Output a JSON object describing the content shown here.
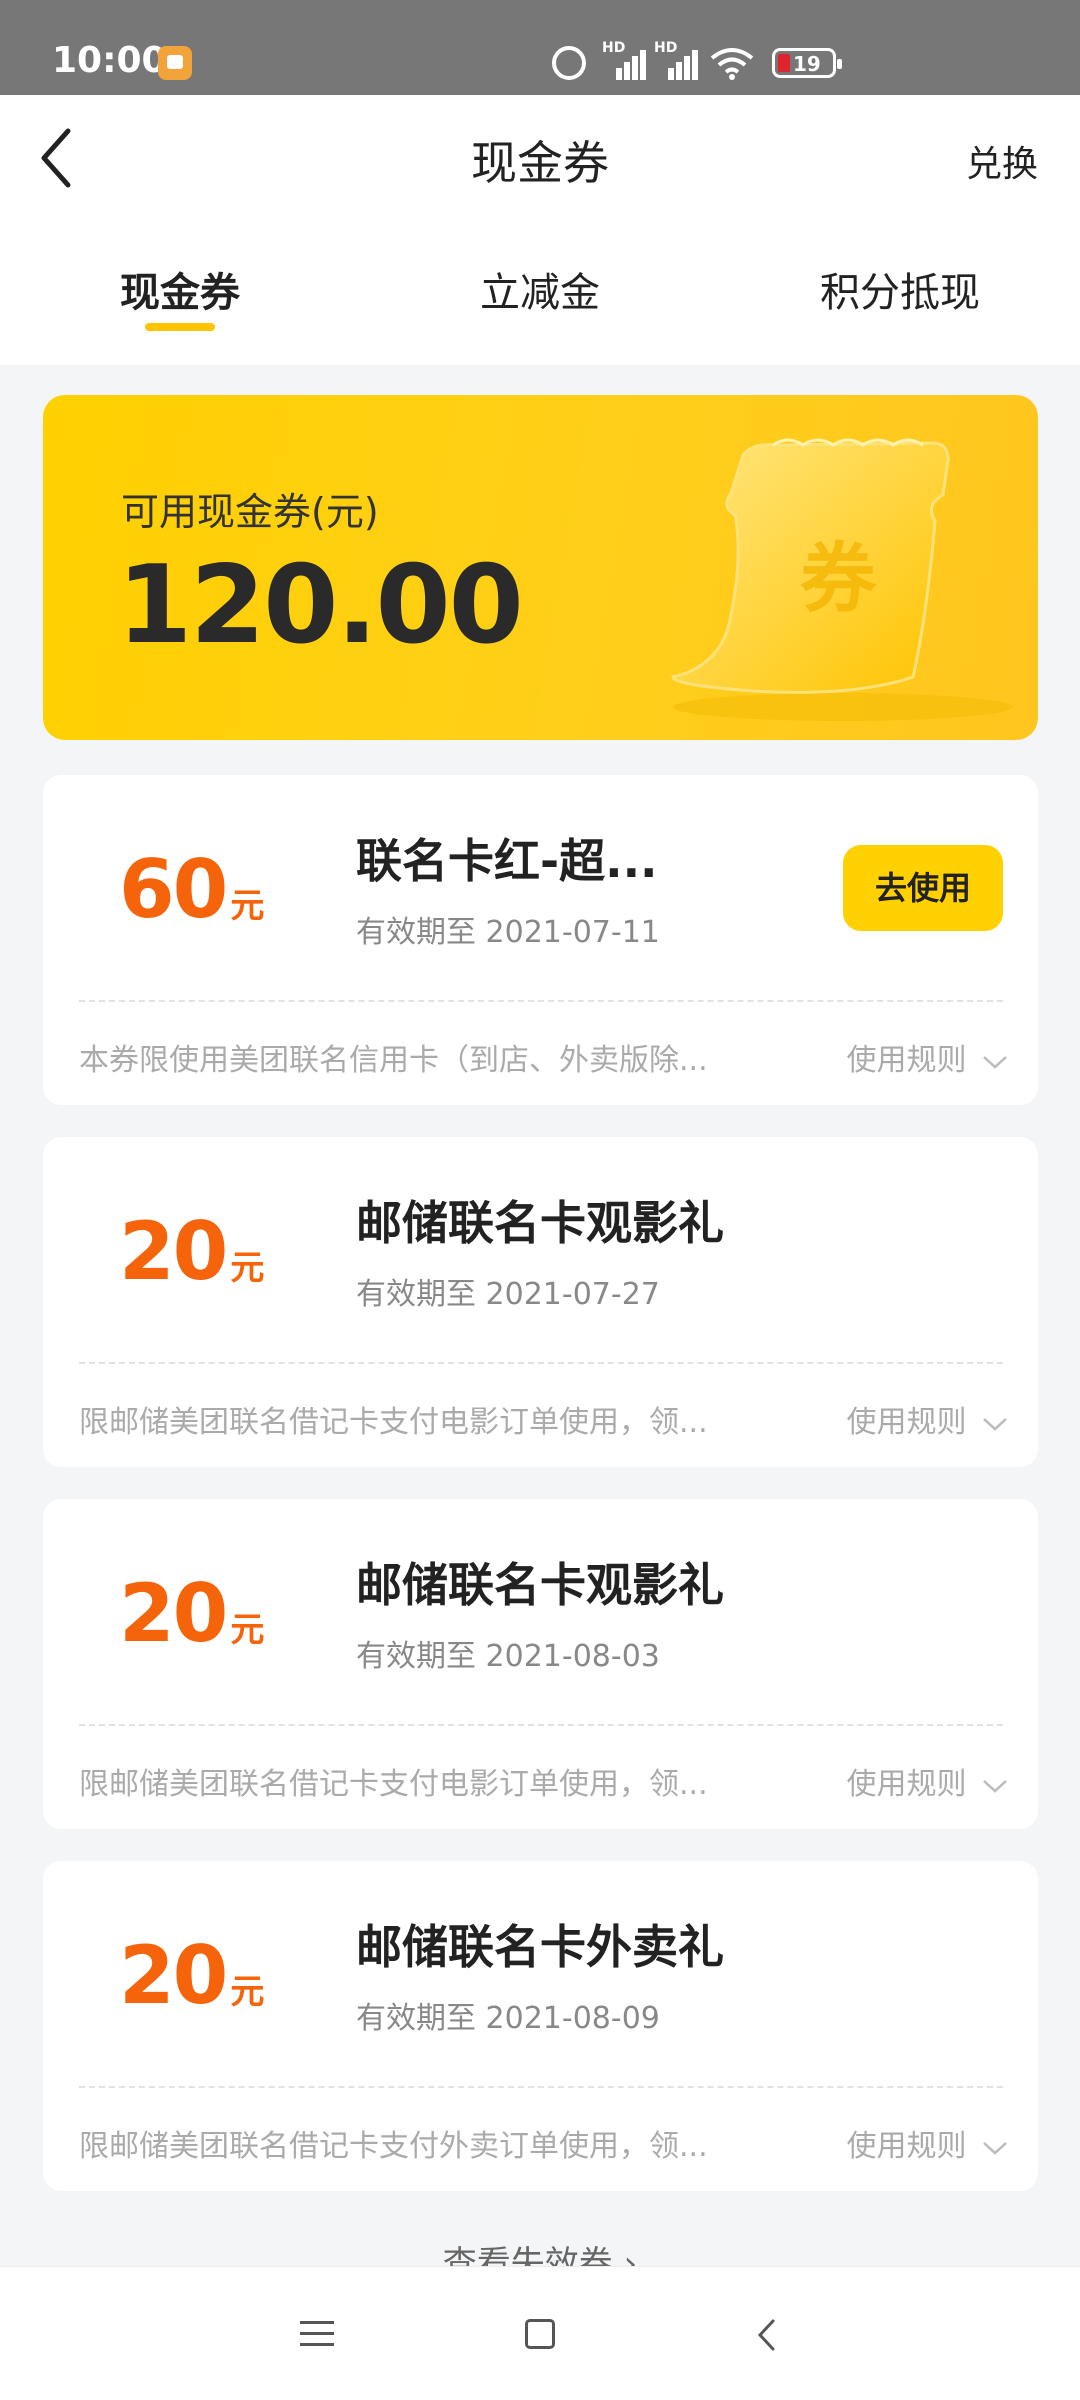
{
  "status_bar": {
    "time": "10:00",
    "battery": "19",
    "signal_label": "HD"
  },
  "header": {
    "title": "现金券",
    "exchange": "兑换"
  },
  "tabs": [
    {
      "label": "现金券",
      "active": true
    },
    {
      "label": "立减金",
      "active": false
    },
    {
      "label": "积分抵现",
      "active": false
    }
  ],
  "summary": {
    "label": "可用现金券(元)",
    "amount": "120.00",
    "ticket_text": "券"
  },
  "coupons": [
    {
      "amount": "60",
      "unit": "元",
      "name": "联名卡红-超...",
      "valid": "有效期至 2021-07-11",
      "use_label": "去使用",
      "desc": "本券限使用美团联名信用卡（到店、外卖版除...",
      "rules": "使用规则"
    },
    {
      "amount": "20",
      "unit": "元",
      "name": "邮储联名卡观影礼",
      "valid": "有效期至 2021-07-27",
      "desc": "限邮储美团联名借记卡支付电影订单使用，领...",
      "rules": "使用规则"
    },
    {
      "amount": "20",
      "unit": "元",
      "name": "邮储联名卡观影礼",
      "valid": "有效期至 2021-08-03",
      "desc": "限邮储美团联名借记卡支付电影订单使用，领...",
      "rules": "使用规则"
    },
    {
      "amount": "20",
      "unit": "元",
      "name": "邮储联名卡外卖礼",
      "valid": "有效期至 2021-08-09",
      "desc": "限邮储美团联名借记卡支付外卖订单使用，领...",
      "rules": "使用规则"
    }
  ],
  "expired_link": "查看失效券 ›",
  "colors": {
    "accent_yellow": "#ffd100",
    "amount_orange": "#f5640a"
  },
  "icons": [
    "back-arrow-icon",
    "ticket-icon",
    "chevron-down-icon",
    "menu-icon",
    "home-icon",
    "nav-back-icon"
  ]
}
